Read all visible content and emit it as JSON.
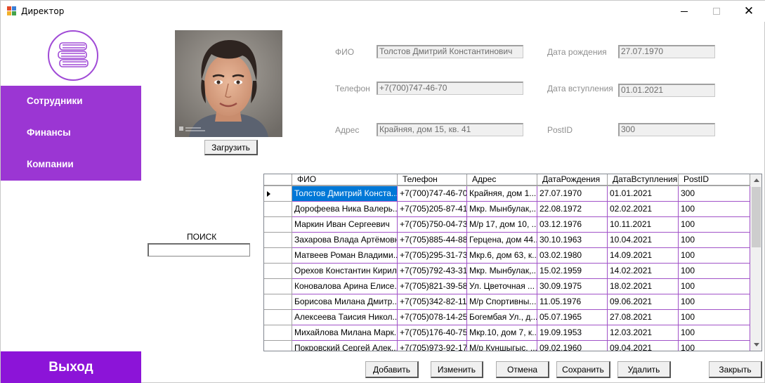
{
  "window": {
    "title": "Директор"
  },
  "sidebar": {
    "items": [
      {
        "label": "Сотрудники"
      },
      {
        "label": "Финансы"
      },
      {
        "label": "Компании"
      }
    ],
    "exit_label": "Выход"
  },
  "photo": {
    "upload_label": "Загрузить"
  },
  "form": {
    "fio_label": "ФИО",
    "fio_value": "Толстов Дмитрий Константинович",
    "phone_label": "Телефон",
    "phone_value": "+7(700)747-46-70",
    "address_label": "Адрес",
    "address_value": "Крайняя, дом 15, кв. 41",
    "birth_label": "Дата рождения",
    "birth_value": "27.07.1970",
    "join_label": "Дата вступления",
    "join_value": "01.01.2021",
    "post_label": "PostID",
    "post_value": "300"
  },
  "search": {
    "label": "ПОИСК",
    "value": ""
  },
  "grid": {
    "columns": [
      "ФИО",
      "Телефон",
      "Адрес",
      "ДатаРождения",
      "ДатаВступления",
      "PostID"
    ],
    "rows": [
      [
        "Толстов Дмитрий Конста...",
        "+7(700)747-46-70",
        "Крайняя, дом 1...",
        "27.07.1970",
        "01.01.2021",
        "300"
      ],
      [
        "Дорофеева Ника Валерь...",
        "+7(705)205-87-41",
        "Мкр. Мынбулак,...",
        "22.08.1972",
        "02.02.2021",
        "100"
      ],
      [
        "Маркин Иван Сергеевич",
        "+7(705)750-04-73",
        "М/р 17, дом 10, ...",
        "03.12.1976",
        "10.11.2021",
        "100"
      ],
      [
        "Захарова Влада Артёмовна",
        "+7(705)885-44-88",
        "Герцена, дом 44...",
        "30.10.1963",
        "10.04.2021",
        "100"
      ],
      [
        "Матвеев Роман Владими...",
        "+7(705)295-31-73",
        "Мкр.6, дом 63, к...",
        "03.02.1980",
        "14.09.2021",
        "100"
      ],
      [
        "Орехов Константин Кирил...",
        "+7(705)792-43-31",
        "Мкр. Мынбулак,...",
        "15.02.1959",
        "14.02.2021",
        "100"
      ],
      [
        "Коновалова Арина Елисе...",
        "+7(705)821-39-58",
        "Ул. Цветочная ...",
        "30.09.1975",
        "18.02.2021",
        "100"
      ],
      [
        "Борисова Милана Дмитр...",
        "+7(705)342-82-11",
        "М/р Спортивны...",
        "11.05.1976",
        "09.06.2021",
        "100"
      ],
      [
        "Алексеева Таисия Никол...",
        "+7(705)078-14-25",
        "Богембая Ул., д...",
        "05.07.1965",
        "27.08.2021",
        "100"
      ],
      [
        "Михайлова Милана Марк...",
        "+7(705)176-40-75",
        "Мкр.10, дом 7, к...",
        "19.09.1953",
        "12.03.2021",
        "100"
      ],
      [
        "Покровский Сергей Алек...",
        "+7(705)973-92-17",
        "М/р Куншыгыс, ...",
        "09.02.1960",
        "09.04.2021",
        "100"
      ]
    ]
  },
  "actions": {
    "add": "Добавить",
    "edit": "Изменить",
    "cancel": "Отмена",
    "save": "Сохранить",
    "delete": "Удалить",
    "close": "Закрыть"
  },
  "colors": {
    "accent": "#9b36d3",
    "exit": "#8c14d8",
    "selection": "#0078d7"
  }
}
